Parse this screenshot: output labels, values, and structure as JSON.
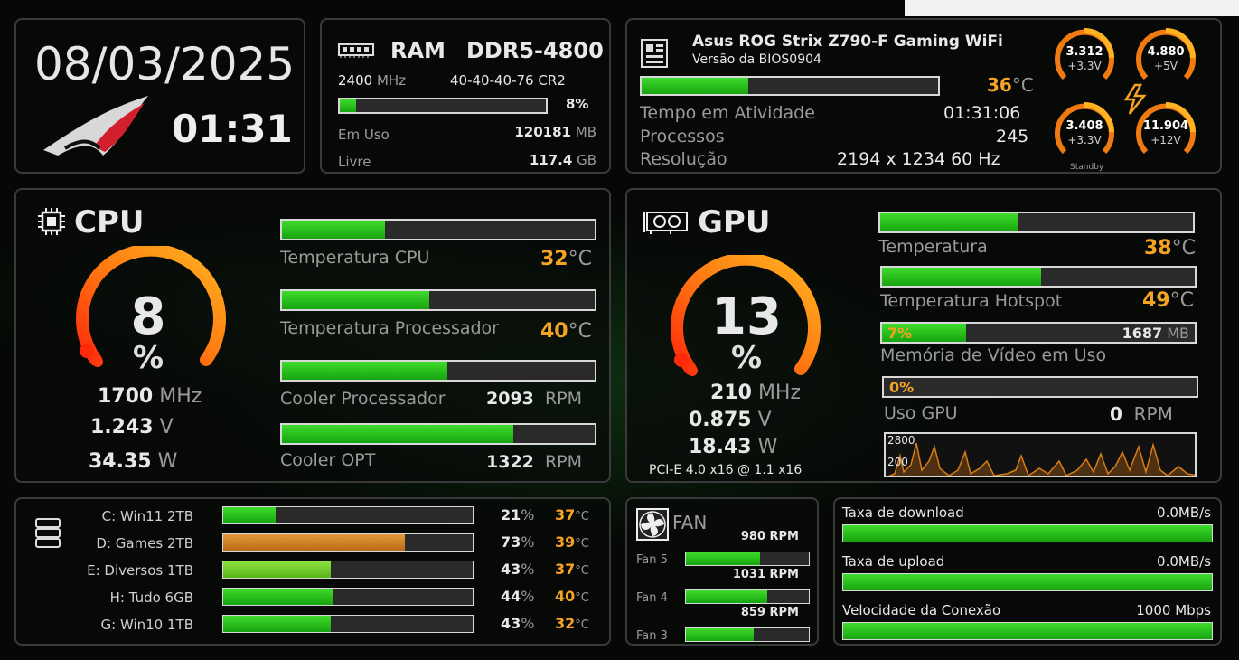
{
  "datetime": {
    "date": "08/03/2025",
    "time": "01:31"
  },
  "ram": {
    "title": "RAM",
    "type": "DDR5-4800",
    "freq_value": "2400",
    "freq_unit": "MHz",
    "timings": "40-40-40-76 CR2",
    "usage_percent": 8,
    "usage_label": "8%",
    "in_use_label": "Em Uso",
    "in_use_value": "120181",
    "in_use_unit": "MB",
    "free_label": "Livre",
    "free_value": "117.4",
    "free_unit": "GB"
  },
  "board": {
    "name": "Asus ROG Strix Z790-F Gaming WiFi",
    "bios": "Versão da BIOS0904",
    "temp_value": "36",
    "temp_unit": "°C",
    "temp_percent": 36,
    "uptime_label": "Tempo em Atividade",
    "uptime_value": "01:31:06",
    "processes_label": "Processos",
    "processes_value": "245",
    "resolution_label": "Resolução",
    "resolution_value": "2194 x 1234  60 Hz",
    "voltages": [
      {
        "value": "3.312",
        "rail": "+3.3V"
      },
      {
        "value": "4.880",
        "rail": "+5V"
      },
      {
        "value": "3.408",
        "rail": "+3.3V"
      },
      {
        "value": "11.904",
        "rail": "+12V"
      }
    ],
    "standby_label": "Standby",
    "accent": "#f5a324"
  },
  "cpu": {
    "title": "CPU",
    "usage_value": "8",
    "usage_unit": "%",
    "usage_percent": 8,
    "clock_value": "1700",
    "clock_unit": "MHz",
    "voltage_value": "1.243",
    "voltage_unit": "V",
    "power_value": "34.35",
    "power_unit": "W",
    "sensors": [
      {
        "label": "Temperatura CPU",
        "value": "32",
        "unit": "°C",
        "percent": 33
      },
      {
        "label": "Temperatura Processador",
        "value": "40",
        "unit": "°C",
        "percent": 47
      },
      {
        "label": "Cooler Processador",
        "value": "2093",
        "unit": "RPM",
        "percent": 53
      },
      {
        "label": "Cooler OPT",
        "value": "1322",
        "unit": "RPM",
        "percent": 74
      }
    ]
  },
  "gpu": {
    "title": "GPU",
    "usage_value": "13",
    "usage_unit": "%",
    "usage_percent": 13,
    "clock_value": "210",
    "clock_unit": "MHz",
    "voltage_value": "0.875",
    "voltage_unit": "V",
    "power_value": "18.43",
    "power_unit": "W",
    "pcie": "PCI-E 4.0 x16 @ 1.1 x16",
    "temp_label": "Temperatura",
    "temp_value": "38",
    "temp_unit": "°C",
    "temp_percent": 44,
    "hotspot_label": "Temperatura Hotspot",
    "hotspot_value": "49",
    "hotspot_unit": "°C",
    "hotspot_percent": 51,
    "vram_percent_label": "7%",
    "vram_percent": 27,
    "vram_value": "1687",
    "vram_unit": "MB",
    "vram_label": "Memória de Vídeo em Uso",
    "usage_bar_label": "0%",
    "usage_bar_percent": 0,
    "gpu_usage_label": "Uso GPU",
    "fan_value": "0",
    "fan_unit": "RPM",
    "graph_labels": [
      "2800",
      "200"
    ]
  },
  "drives": [
    {
      "name": "C: Win11 2TB",
      "percent_value": "21",
      "percent": 21,
      "temp": "37",
      "color": "green"
    },
    {
      "name": "D: Games 2TB",
      "percent_value": "73",
      "percent": 73,
      "temp": "39",
      "color": "orange"
    },
    {
      "name": "E: Diversos 1TB",
      "percent_value": "43",
      "percent": 43,
      "temp": "37",
      "color": "lime"
    },
    {
      "name": "H: Tudo 6GB",
      "percent_value": "44",
      "percent": 44,
      "temp": "40",
      "color": "green"
    },
    {
      "name": "G: Win10 1TB",
      "percent_value": "43",
      "percent": 43,
      "temp": "32",
      "color": "green"
    }
  ],
  "drives_units": {
    "percent_symbol": "%",
    "temp_unit": "°C"
  },
  "fans": {
    "title": "FAN",
    "items": [
      {
        "label": "Fan 5",
        "rpm": "980 RPM",
        "percent": 60
      },
      {
        "label": "Fan 4",
        "rpm": "1031 RPM",
        "percent": 66
      },
      {
        "label": "Fan 3",
        "rpm": "859 RPM",
        "percent": 55
      }
    ]
  },
  "network": {
    "download_label": "Taxa de download",
    "download_value": "0.0MB/s",
    "upload_label": "Taxa de upload",
    "upload_value": "0.0MB/s",
    "speed_label": "Velocidade da Conexão",
    "speed_value": "1000 Mbps"
  },
  "icons": {
    "ram": "ram-module-icon",
    "board": "motherboard-icon",
    "cpu": "cpu-chip-icon",
    "gpu": "graphics-card-icon",
    "drives": "drive-stack-icon",
    "fan": "fan-icon",
    "logo": "rog-logo",
    "bolt": "lightning-bolt-icon"
  },
  "colors": {
    "green": "#2bc41c",
    "orange": "#f5a324",
    "gauge_start": "#ff3a10",
    "gauge_end": "#ffb020"
  }
}
